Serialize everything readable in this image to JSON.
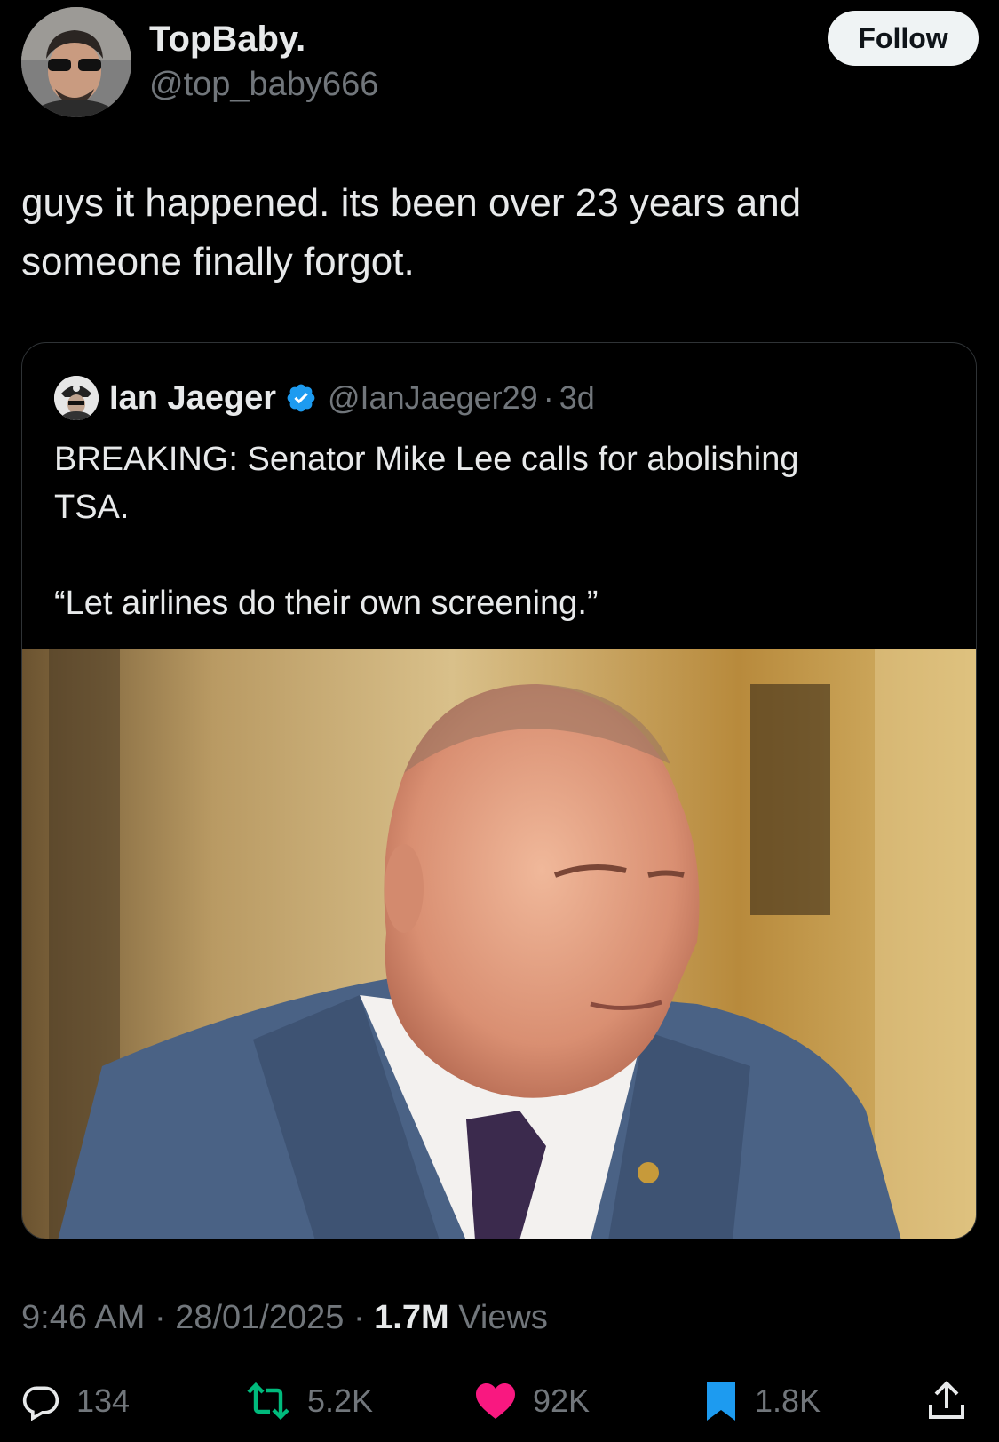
{
  "author": {
    "display_name": "TopBaby.",
    "handle": "@top_baby666",
    "follow_label": "Follow",
    "avatar_icon": "person-avatar"
  },
  "tweet": {
    "text_line1": "guys it happened. its been over 23 years and",
    "text_line2": "someone finally forgot."
  },
  "quoted_tweet": {
    "display_name": "Ian Jaeger",
    "verified": true,
    "handle": "@IanJaeger29",
    "separator": "·",
    "age": "3d",
    "text_line1": "BREAKING: Senator Mike Lee calls for abolishing",
    "text_line2": "TSA.",
    "quote": "“Let airlines do their own screening.”",
    "photo_icon": "senator-photo"
  },
  "meta": {
    "time": "9:46 AM",
    "sep1": " · ",
    "date": "28/01/2025",
    "sep2": " · ",
    "views_count": "1.7M",
    "views_label": " Views"
  },
  "actions": {
    "replies": "134",
    "retweets": "5.2K",
    "likes": "92K",
    "bookmarks": "1.8K"
  },
  "colors": {
    "background": "#000000",
    "text": "#e7e9ea",
    "secondary": "#71767b",
    "verified_blue": "#1d9bf0",
    "retweet_green": "#00ba7c",
    "like_pink": "#f91880",
    "bookmark_blue": "#1d9bf0"
  }
}
